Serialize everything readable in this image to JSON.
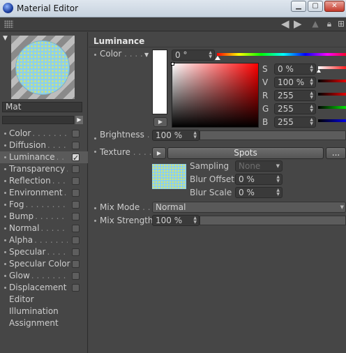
{
  "window": {
    "title": "Material Editor"
  },
  "material": {
    "name": "Mat"
  },
  "channels": [
    {
      "label": "Color",
      "checked": false,
      "selected": false
    },
    {
      "label": "Diffusion",
      "checked": false,
      "selected": false
    },
    {
      "label": "Luminance",
      "checked": true,
      "selected": true
    },
    {
      "label": "Transparency",
      "checked": false,
      "selected": false
    },
    {
      "label": "Reflection",
      "checked": false,
      "selected": false
    },
    {
      "label": "Environment",
      "checked": false,
      "selected": false
    },
    {
      "label": "Fog",
      "checked": false,
      "selected": false
    },
    {
      "label": "Bump",
      "checked": false,
      "selected": false
    },
    {
      "label": "Normal",
      "checked": false,
      "selected": false
    },
    {
      "label": "Alpha",
      "checked": false,
      "selected": false
    },
    {
      "label": "Specular",
      "checked": false,
      "selected": false
    },
    {
      "label": "Specular Color",
      "checked": false,
      "selected": false
    },
    {
      "label": "Glow",
      "checked": false,
      "selected": false
    },
    {
      "label": "Displacement",
      "checked": false,
      "selected": false
    }
  ],
  "extra_items": [
    "Editor",
    "Illumination",
    "Assignment"
  ],
  "panel": {
    "section_title": "Luminance",
    "color_label": "Color",
    "hue_value": "0 °",
    "channels": [
      {
        "letter": "S",
        "value": "0 %"
      },
      {
        "letter": "V",
        "value": "100 %"
      },
      {
        "letter": "R",
        "value": "255"
      },
      {
        "letter": "G",
        "value": "255"
      },
      {
        "letter": "B",
        "value": "255"
      }
    ],
    "brightness_label": "Brightness",
    "brightness_value": "100 %",
    "texture_label": "Texture",
    "texture_name": "Spots",
    "texture_more": "...",
    "sampling_label": "Sampling",
    "sampling_value": "None",
    "blur_offset_label": "Blur Offset",
    "blur_offset_value": "0 %",
    "blur_scale_label": "Blur Scale",
    "blur_scale_value": "0 %",
    "mix_mode_label": "Mix Mode",
    "mix_mode_value": "Normal",
    "mix_strength_label": "Mix Strength",
    "mix_strength_value": "100 %"
  }
}
